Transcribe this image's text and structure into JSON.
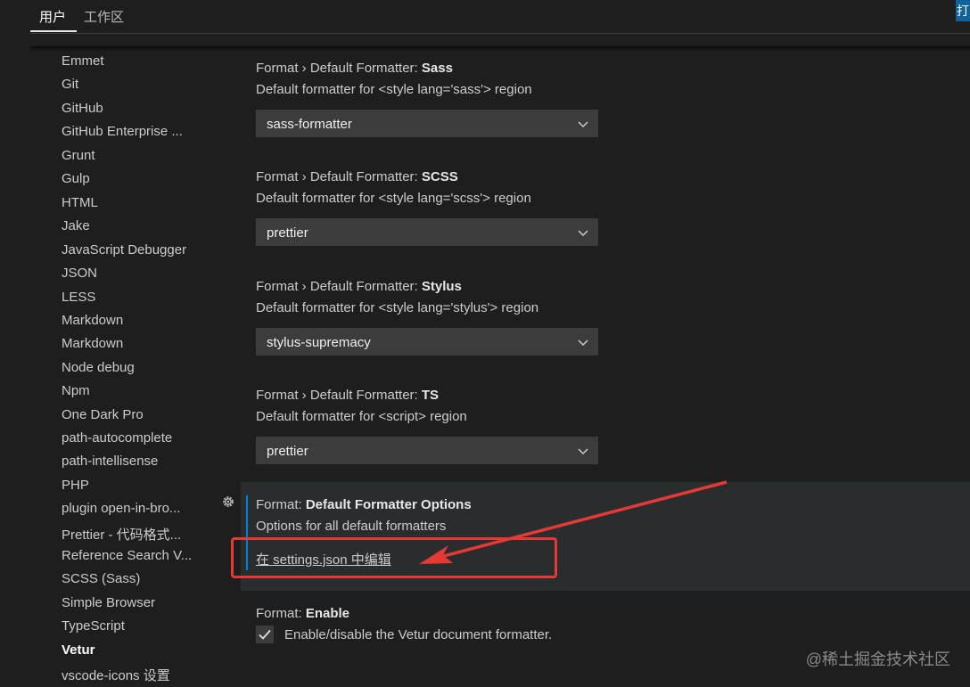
{
  "tabs": {
    "user": "用户",
    "workspace": "工作区",
    "corner": "打"
  },
  "toc": [
    "Emmet",
    "Git",
    "GitHub",
    "GitHub Enterprise ...",
    "Grunt",
    "Gulp",
    "HTML",
    "Jake",
    "JavaScript Debugger",
    "JSON",
    "LESS",
    "Markdown",
    "Markdown",
    "Node debug",
    "Npm",
    "One Dark Pro",
    "path-autocomplete",
    "path-intellisense",
    "PHP",
    "plugin open-in-bro...",
    "Prettier - 代码格式...",
    "Reference Search V...",
    "SCSS (Sass)",
    "Simple Browser",
    "TypeScript",
    "Vetur",
    "vscode-icons 设置"
  ],
  "toc_active": "Vetur",
  "settings": {
    "sass": {
      "prefix": "Format › Default Formatter: ",
      "name": "Sass",
      "desc": "Default formatter for <style lang='sass'> region",
      "value": "sass-formatter"
    },
    "scss": {
      "prefix": "Format › Default Formatter: ",
      "name": "SCSS",
      "desc": "Default formatter for <style lang='scss'> region",
      "value": "prettier"
    },
    "stylus": {
      "prefix": "Format › Default Formatter: ",
      "name": "Stylus",
      "desc": "Default formatter for <style lang='stylus'> region",
      "value": "stylus-supremacy"
    },
    "ts": {
      "prefix": "Format › Default Formatter: ",
      "name": "TS",
      "desc": "Default formatter for <script> region",
      "value": "prettier"
    },
    "options": {
      "prefix": "Format: ",
      "name": "Default Formatter Options",
      "desc": "Options for all default formatters",
      "link": "在 settings.json 中编辑"
    },
    "enable": {
      "prefix": "Format: ",
      "name": "Enable",
      "label": "Enable/disable the Vetur document formatter.",
      "checked": true
    }
  },
  "icons": {
    "gear": "gear-icon",
    "chevron": "chevron-down-icon",
    "check": "check-icon"
  },
  "colors": {
    "annotation": "#e53935",
    "focus": "#007fd4",
    "background": "#1e1e1e"
  },
  "watermark": "@稀土掘金技术社区"
}
